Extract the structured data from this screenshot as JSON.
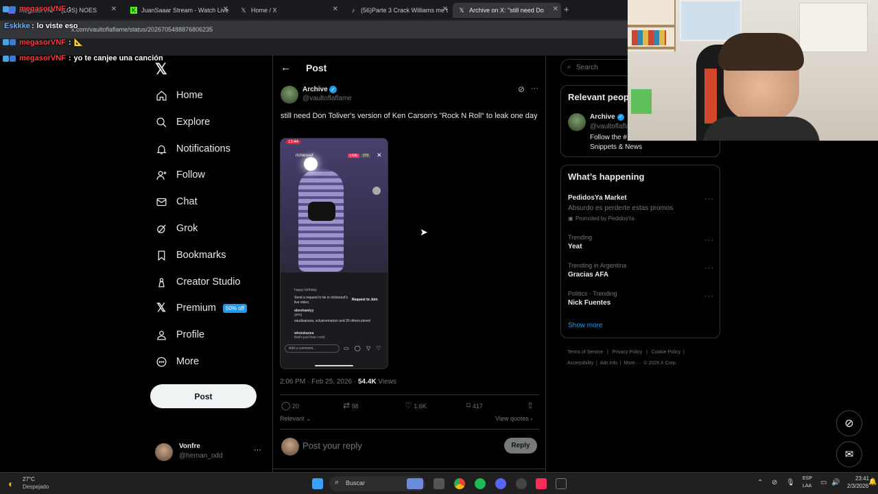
{
  "browser": {
    "tabs": [
      {
        "label": "megasorVNF · (LOS) NOES"
      },
      {
        "label": "JuanSaaar Stream - Watch Live"
      },
      {
        "label": "Home / X"
      },
      {
        "label": "(56)Parte 3 Crack Williams me t"
      },
      {
        "label": "Archive on X: \"still need Do"
      }
    ],
    "url": "x.com/vaultoflaflame/status/2026705488876806235"
  },
  "chat": [
    {
      "user": "megasorVNF",
      "sep": ":",
      "message": "",
      "color": "#ff3b3b"
    },
    {
      "user": "Eskkke",
      "sep": ":",
      "message": "lo viste eso",
      "color": "#6fb7ff"
    },
    {
      "user": "megasorVNF",
      "sep": ":",
      "message": "📐",
      "color": "#ff3b3b"
    },
    {
      "user": "megasorVNF",
      "sep": ":",
      "message": "yo te canjee una canción",
      "color": "#ff3b3b"
    }
  ],
  "sidebar": {
    "items": [
      {
        "label": "Home"
      },
      {
        "label": "Explore"
      },
      {
        "label": "Notifications"
      },
      {
        "label": "Follow"
      },
      {
        "label": "Chat"
      },
      {
        "label": "Grok"
      },
      {
        "label": "Bookmarks"
      },
      {
        "label": "Creator Studio"
      },
      {
        "label": "Premium"
      },
      {
        "label": "Profile"
      },
      {
        "label": "More"
      }
    ],
    "premium_badge": "50% off",
    "post_button": "Post",
    "account": {
      "name": "Vonfre",
      "handle": "@hernan_odd",
      "more": "···"
    }
  },
  "post": {
    "header_title": "Post",
    "author_name": "Archive",
    "author_handle": "@vaultoflaflame",
    "text": "still need Don Toliver's version of Ken Carson's ”Rock N Roll“ to leak one day",
    "timestamp": "2:06 PM · Feb 25, 2026 · ",
    "views_count": "54.4K",
    "views_label": " Views",
    "replies": "20",
    "reposts": "98",
    "likes": "1.6K",
    "bookmarks": "417",
    "sort_label": "Relevant",
    "view_quotes": "View quotes",
    "reply_placeholder": "Post your reply",
    "reply_button": "Reply"
  },
  "phone": {
    "time": "13:44",
    "user": "richiesouf",
    "live": "LIVE",
    "viewers": "273",
    "comment_1": "happy birthday",
    "request_text": "Send a request to be in richiesouf's live video.",
    "request_button": "Request to Join",
    "user_2": "abeshawtyy",
    "msg_2": "gang",
    "user_3": "saudisaravia, xclusivemarion and 30 others joined",
    "user_4": "whoiskanea",
    "msg_4": "that's just how i rock",
    "add_comment": "Add a comment..."
  },
  "right": {
    "search_placeholder": "Search",
    "relevant_title": "Relevant people",
    "relevant_name": "Archive",
    "relevant_handle": "@vaultoflaflame",
    "relevant_bio_1": "Follow the #",
    "relevant_bio_2": "Snippets & News",
    "happening_title": "What’s happening",
    "trends": [
      {
        "context": "",
        "title": "PedidosYa Market",
        "sub": "Absurdo es perderte estas promos",
        "promo": "Promoted by PedidosYa"
      },
      {
        "context": "Trending",
        "title": "Yeat"
      },
      {
        "context": "Trending in Argentina",
        "title": "Gracias AFA"
      },
      {
        "context": "Politics · Trending",
        "title": "Nick Fuentes"
      }
    ],
    "show_more": "Show more",
    "footer": [
      "Terms of Service",
      "|",
      "Privacy Policy",
      "|",
      "Cookie Policy",
      "|",
      "Accessibility",
      "|",
      "Ads info",
      "|",
      "More ···",
      "© 2026 X Corp."
    ]
  },
  "taskbar": {
    "weather_temp": "27°C",
    "weather_desc": "Despejado",
    "search_label": "Buscar",
    "lang_1": "ESP",
    "lang_2": "LAA",
    "time": "23:41",
    "date": "2/3/2026"
  }
}
